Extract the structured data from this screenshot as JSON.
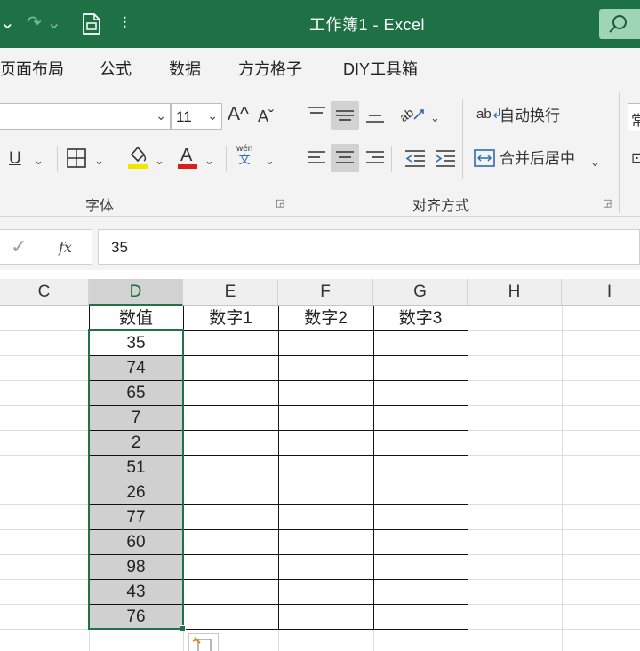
{
  "titlebar": {
    "title": "工作簿1  -  Excel",
    "undo_label": "⌄",
    "redo_label": "↷ ⌄",
    "customize_label": "⫶"
  },
  "menu": {
    "tabs": [
      "页面布局",
      "公式",
      "数据",
      "方方格子",
      "DIY工具箱"
    ]
  },
  "ribbon": {
    "font_name": "",
    "font_size": "11",
    "grow_font": "A^",
    "shrink_font": "Aˇ",
    "underline": "U",
    "phonetic_top": "wén",
    "phonetic_bottom": "文",
    "wrap_text": "自动换行",
    "wrap_text_icon": "ab",
    "merge_center": "合并后居中",
    "font_group": "字体",
    "align_group": "对齐方式",
    "partial_label": "常"
  },
  "formula_bar": {
    "fx": "fx",
    "value": "35"
  },
  "columns": [
    "C",
    "D",
    "E",
    "F",
    "G",
    "H",
    "I"
  ],
  "active_column": "D",
  "table": {
    "headers": [
      "数值",
      "数字1",
      "数字2",
      "数字3"
    ],
    "values": [
      "35",
      "74",
      "65",
      "7",
      "2",
      "51",
      "26",
      "77",
      "60",
      "98",
      "43",
      "76"
    ]
  },
  "colors": {
    "title_bg": "#1e7145",
    "accent": "#217346",
    "selection_fill": "#d0d0d0"
  }
}
